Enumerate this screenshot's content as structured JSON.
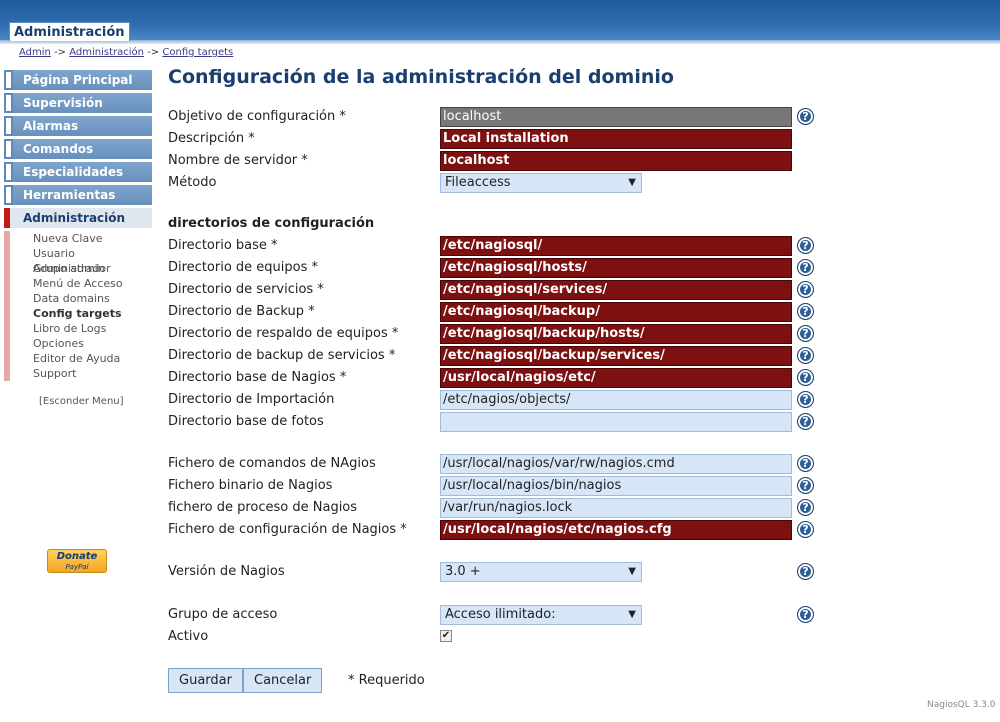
{
  "header": {
    "tab": "Administración"
  },
  "breadcrumb": {
    "items": [
      "Admin",
      "Administración",
      "Config targets"
    ],
    "sep": "->"
  },
  "sidebar": {
    "menu": [
      {
        "label": "Página Principal"
      },
      {
        "label": "Supervisión"
      },
      {
        "label": "Alarmas"
      },
      {
        "label": "Comandos"
      },
      {
        "label": "Especialidades"
      },
      {
        "label": "Herramientas"
      },
      {
        "label": "Administración"
      }
    ],
    "submenu": [
      "Nueva Clave",
      "Usuario Administrador",
      "Grupo admin",
      "Menú de Acceso",
      "Data domains",
      "Config targets",
      "Libro de Logs",
      "Opciones",
      "Editor de Ayuda",
      "Support"
    ],
    "hide_menu": "[Esconder Menu]",
    "donate": {
      "line1": "Donate",
      "line2": "PayPal"
    }
  },
  "page": {
    "title": "Configuración de la administración del dominio"
  },
  "form": {
    "target_label": "Objetivo de configuración *",
    "target_value": "localhost",
    "desc_label": "Descripción *",
    "desc_value": "Local installation",
    "server_label": "Nombre de servidor *",
    "server_value": "localhost",
    "method_label": "Método",
    "method_value": "Fileaccess",
    "dirs_heading": "directorios de configuración",
    "base_label": "Directorio base *",
    "base_value": "/etc/nagiosql/",
    "hosts_label": "Directorio de equipos *",
    "hosts_value": "/etc/nagiosql/hosts/",
    "services_label": "Directorio de servicios *",
    "services_value": "/etc/nagiosql/services/",
    "backup_label": "Directorio de Backup *",
    "backup_value": "/etc/nagiosql/backup/",
    "backup_hosts_label": "Directorio de respaldo de equipos *",
    "backup_hosts_value": "/etc/nagiosql/backup/hosts/",
    "backup_services_label": "Directorio de backup de servicios *",
    "backup_services_value": "/etc/nagiosql/backup/services/",
    "nagios_base_label": "Directorio base de Nagios *",
    "nagios_base_value": "/usr/local/nagios/etc/",
    "import_label": "Directorio de Importación",
    "import_value": "/etc/nagios/objects/",
    "pictures_label": "Directorio base de fotos",
    "pictures_value": "",
    "cmd_file_label": "Fichero de comandos de NAgios",
    "cmd_file_value": "/usr/local/nagios/var/rw/nagios.cmd",
    "binary_label": "Fichero binario de Nagios",
    "binary_value": "/usr/local/nagios/bin/nagios",
    "process_label": "fichero de proceso de Nagios",
    "process_value": "/var/run/nagios.lock",
    "config_file_label": "Fichero de configuración de Nagios *",
    "config_file_value": "/usr/local/nagios/etc/nagios.cfg",
    "version_label": "Versión de Nagios",
    "version_value": "3.0 +",
    "group_label": "Grupo de acceso",
    "group_value": "Acceso ilimitado:",
    "active_label": "Activo",
    "active_checked": true,
    "save": "Guardar",
    "cancel": "Cancelar",
    "required_note": "* Requerido"
  },
  "help_icon_glyph": "?",
  "footer": {
    "version": "NagiosQL 3.3.0"
  },
  "colors": {
    "required_field": "#7d1010",
    "optional_field": "#d7e6f7",
    "title": "#1a3f6f",
    "header": "#2f6db0"
  }
}
